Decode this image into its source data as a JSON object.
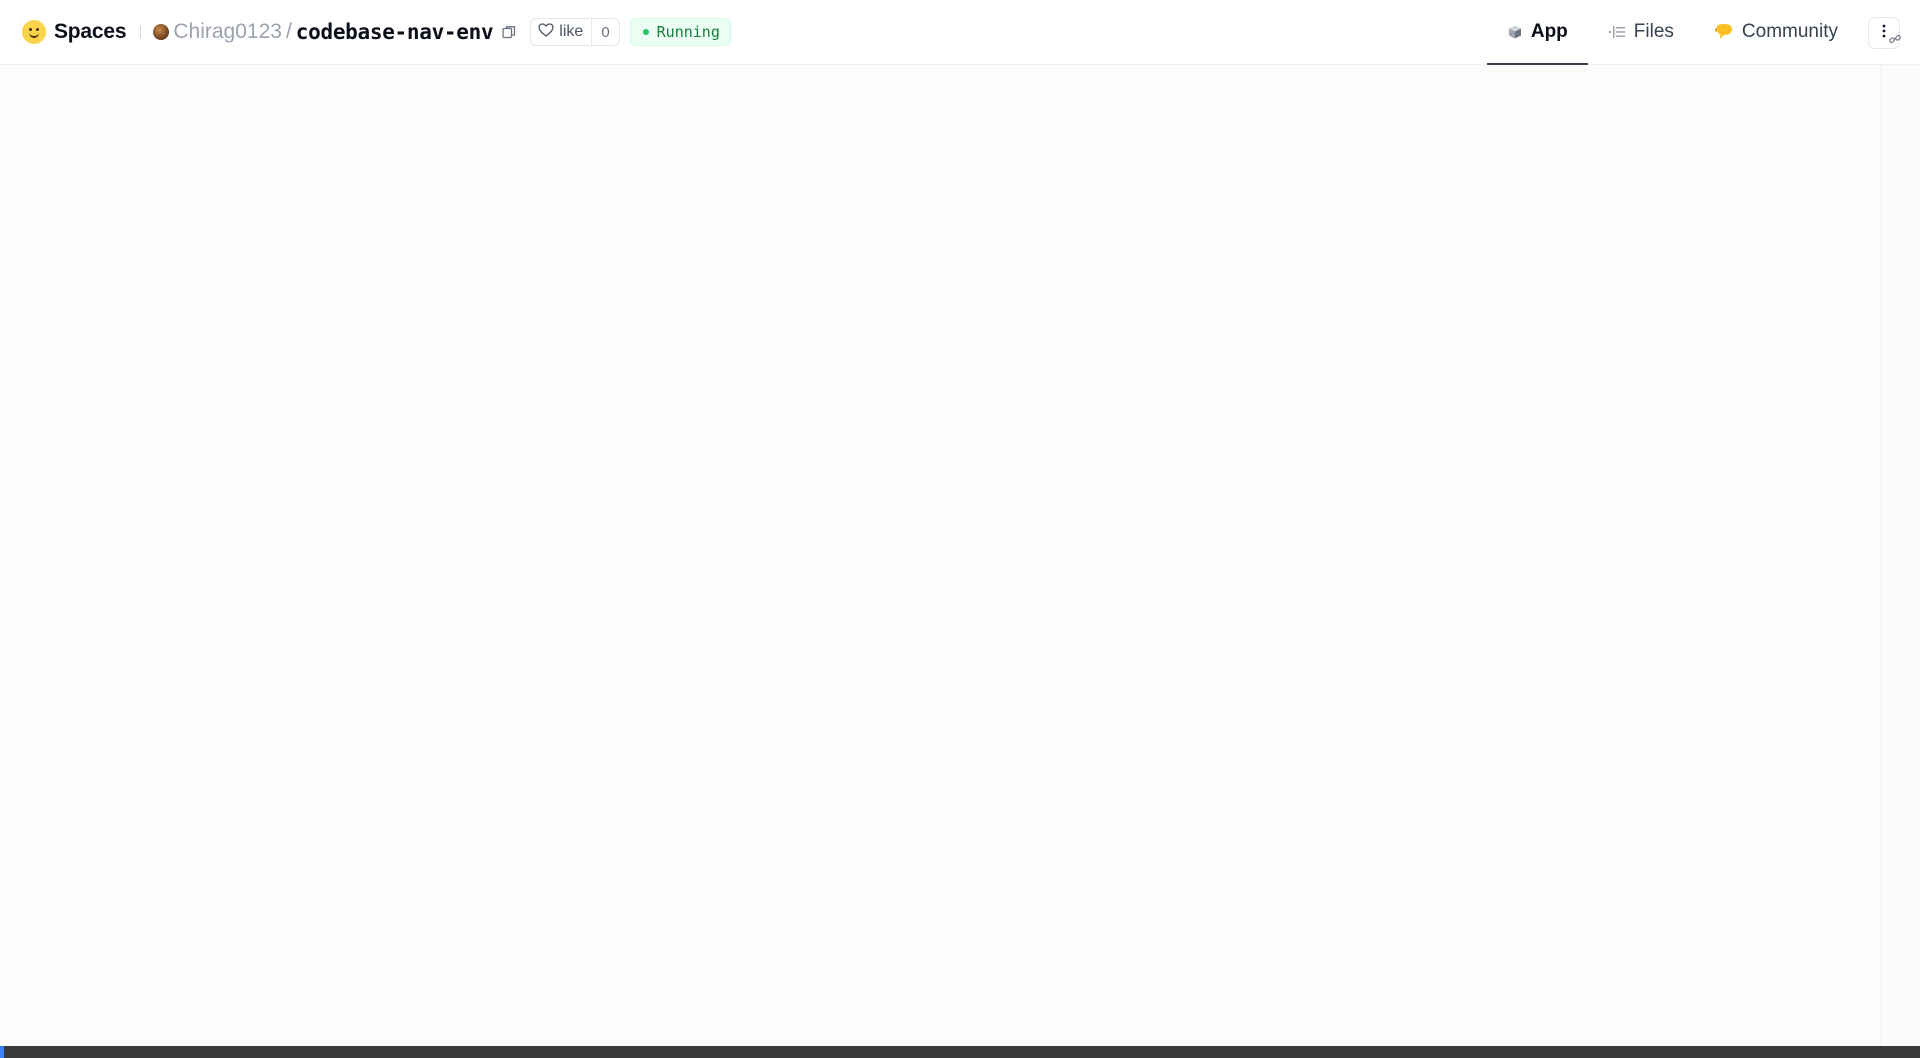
{
  "header": {
    "brand_label": "Spaces",
    "owner": "Chirag0123",
    "separator": "/",
    "repo_name": "codebase-nav-env",
    "like_label": "like",
    "like_count": "0",
    "status_label": "Running"
  },
  "tabs": [
    {
      "label": "App",
      "icon": "cube-icon",
      "active": true
    },
    {
      "label": "Files",
      "icon": "files-icon",
      "active": false
    },
    {
      "label": "Community",
      "icon": "community-icon",
      "active": false
    }
  ],
  "colors": {
    "status_green": "#22c55e",
    "status_bg": "#ecfdf3",
    "brand_yellow": "#fcd34d",
    "active_underline": "#374151",
    "bottom_bar": "#3a3a3c",
    "bottom_accent": "#3b82f6"
  }
}
